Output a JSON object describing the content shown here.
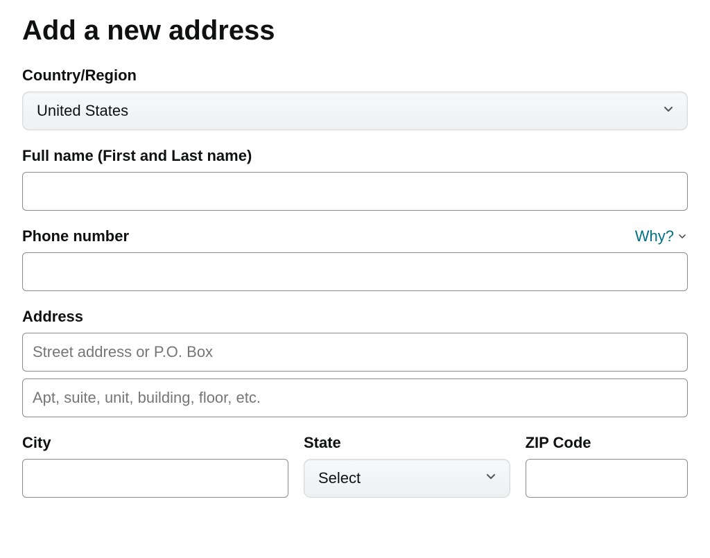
{
  "title": "Add a new address",
  "country": {
    "label": "Country/Region",
    "value": "United States"
  },
  "fullname": {
    "label": "Full name (First and Last name)",
    "value": ""
  },
  "phone": {
    "label": "Phone number",
    "value": "",
    "why_text": "Why?"
  },
  "address": {
    "label": "Address",
    "line1_placeholder": "Street address or P.O. Box",
    "line1_value": "",
    "line2_placeholder": "Apt, suite, unit, building, floor, etc.",
    "line2_value": ""
  },
  "city": {
    "label": "City",
    "value": ""
  },
  "state": {
    "label": "State",
    "value": "Select"
  },
  "zip": {
    "label": "ZIP Code",
    "value": ""
  }
}
